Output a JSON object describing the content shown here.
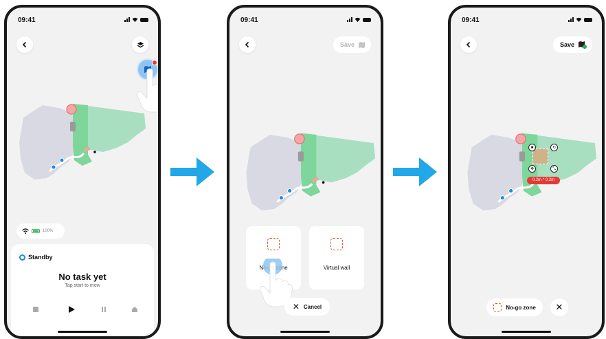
{
  "colors": {
    "accent_blue": "#1e88e5",
    "arrow_blue": "#22a7e8",
    "map_grey": "#d9d9e3",
    "map_green_light": "#a8dfc0",
    "map_green": "#7ed69b",
    "nogo_orange": "#e64a19",
    "alert_red": "#e53935"
  },
  "screens": [
    {
      "status_time": "09:41",
      "icons": [
        "back-icon",
        "layers-icon",
        "map-edit-icon",
        "hand-pointer-icon",
        "wifi-icon",
        "battery-icon"
      ],
      "battery_label": "100%",
      "status": {
        "label": "Standby",
        "title": "No task yet",
        "subtitle": "Tap start to mow"
      },
      "controls": [
        "stop-icon",
        "play-icon",
        "pause-icon",
        "home-icon"
      ]
    },
    {
      "status_time": "09:41",
      "save_label": "Save",
      "save_enabled": false,
      "options": [
        {
          "label": "No-go zone",
          "icon": "no-go-zone-icon"
        },
        {
          "label": "Virtual wall",
          "icon": "virtual-wall-icon"
        }
      ],
      "cancel_label": "Cancel"
    },
    {
      "status_time": "09:41",
      "save_label": "Save",
      "save_enabled": true,
      "zone_size": "0.2m * 0.2m",
      "active_tool": "No-go zone"
    }
  ],
  "flow_arrows": 2
}
